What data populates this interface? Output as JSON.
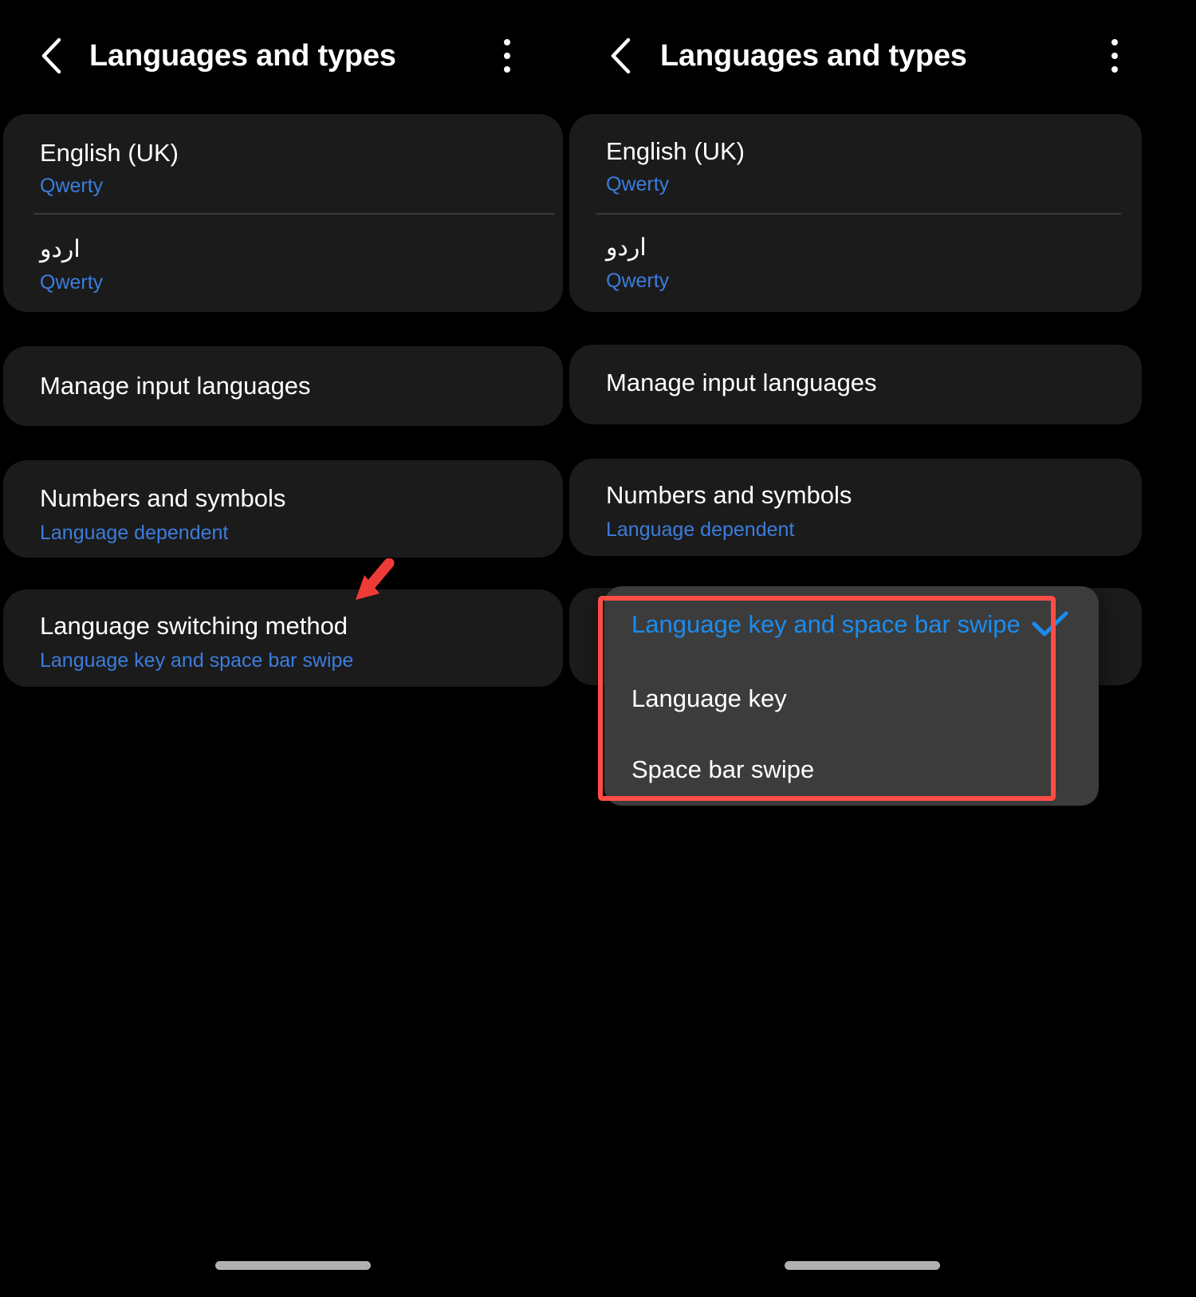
{
  "app": {
    "title": "Languages and types",
    "back_icon": "chevron-left-icon",
    "overflow_icon": "more-vertical-icon"
  },
  "accent": {
    "blue": "#3b7ddd",
    "popup_blue": "#1a8cf0",
    "highlight_red": "#ff4d45",
    "card_bg": "#1b1b1b",
    "popup_bg": "#3c3c3c",
    "screen_bg": "#000000",
    "text_primary": "#ffffff",
    "divider": "#3a3a3a"
  },
  "languages": [
    {
      "name": "English (UK)",
      "layout": "Qwerty",
      "rtl": false
    },
    {
      "name": "اردو",
      "layout": "Qwerty",
      "rtl": true
    }
  ],
  "settings": [
    {
      "title": "Manage input languages",
      "subtitle": ""
    },
    {
      "title": "Numbers and symbols",
      "subtitle": "Language dependent"
    },
    {
      "title": "Language switching method",
      "subtitle": "Language key and space bar swipe"
    }
  ],
  "dropdown": {
    "check_icon": "check-icon",
    "options": [
      {
        "label": "Language key and space bar swipe",
        "selected": true
      },
      {
        "label": "Language key",
        "selected": false
      },
      {
        "label": "Space bar swipe",
        "selected": false
      }
    ]
  },
  "annotations": {
    "arrow": "red-arrow-pointer",
    "highlight": "red-highlight-rectangle"
  }
}
